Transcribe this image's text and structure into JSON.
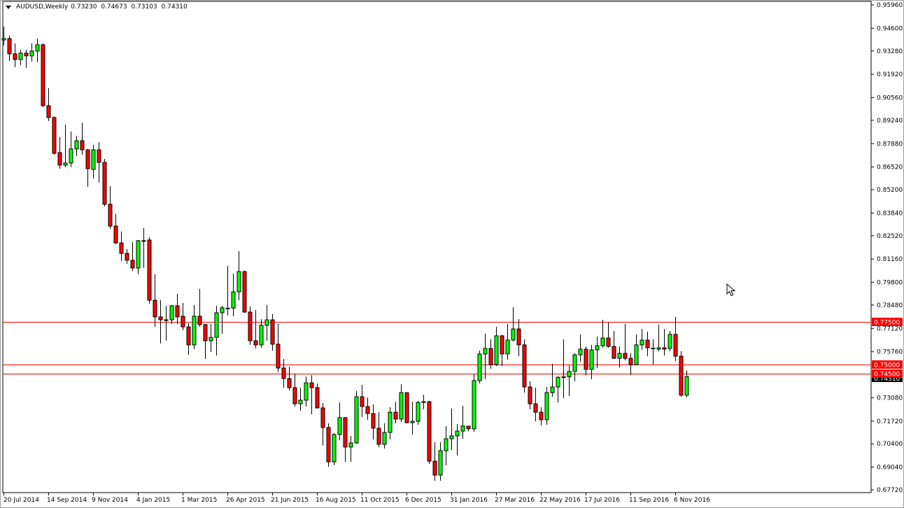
{
  "header": {
    "symbol_timeframe": "AUDUSD,Weekly",
    "open": "0.73230",
    "high": "0.74673",
    "low": "0.73103",
    "close": "0.74310"
  },
  "colors": {
    "bull": "#00ff00",
    "bear": "#ff0000",
    "outline": "#000000",
    "hline": "#ff0000",
    "bid_label_bg": "#000000"
  },
  "chart_data": {
    "type": "candlestick",
    "title": "AUDUSD,Weekly",
    "ylim": [
      0.6772,
      0.9596
    ],
    "grid": false,
    "y_ticks": [
      "0.95960",
      "0.94600",
      "0.93280",
      "0.91920",
      "0.90560",
      "0.89240",
      "0.87880",
      "0.86520",
      "0.85200",
      "0.83840",
      "0.82520",
      "0.81160",
      "0.79800",
      "0.78480",
      "0.77120",
      "0.75760",
      "0.73080",
      "0.71720",
      "0.70400",
      "0.69040",
      "0.67720"
    ],
    "x_ticks": [
      {
        "index": 0,
        "label": "20 Jul 2014"
      },
      {
        "index": 8,
        "label": "14 Sep 2014"
      },
      {
        "index": 16,
        "label": "9 Nov 2014"
      },
      {
        "index": 24,
        "label": "4 Jan 2015"
      },
      {
        "index": 32,
        "label": "1 Mar 2015"
      },
      {
        "index": 40,
        "label": "26 Apr 2015"
      },
      {
        "index": 48,
        "label": "21 Jun 2015"
      },
      {
        "index": 56,
        "label": "16 Aug 2015"
      },
      {
        "index": 64,
        "label": "11 Oct 2015"
      },
      {
        "index": 72,
        "label": "6 Dec 2015"
      },
      {
        "index": 80,
        "label": "31 Jan 2016"
      },
      {
        "index": 88,
        "label": "27 Mar 2016"
      },
      {
        "index": 96,
        "label": "22 May 2016"
      },
      {
        "index": 104,
        "label": "17 Jul 2016"
      },
      {
        "index": 112,
        "label": "11 Sep 2016"
      },
      {
        "index": 120,
        "label": "6 Nov 2016"
      }
    ],
    "horizontal_lines": [
      {
        "price": 0.775,
        "label": "0.77500"
      },
      {
        "price": 0.75,
        "label": "0.75000"
      },
      {
        "price": 0.745,
        "label": "0.74500"
      }
    ],
    "current_price": {
      "price": 0.7431,
      "label": "0.74310"
    },
    "ohlc_fields": [
      "open",
      "high",
      "low",
      "close"
    ],
    "ohlc": [
      [
        0.9392,
        0.947,
        0.936,
        0.94
      ],
      [
        0.94,
        0.9417,
        0.927,
        0.9311
      ],
      [
        0.9311,
        0.9372,
        0.9233,
        0.9278
      ],
      [
        0.9278,
        0.9335,
        0.9246,
        0.9315
      ],
      [
        0.9315,
        0.9335,
        0.9229,
        0.9299
      ],
      [
        0.9299,
        0.9372,
        0.9266,
        0.9327
      ],
      [
        0.9327,
        0.94,
        0.9262,
        0.9364
      ],
      [
        0.9364,
        0.9372,
        0.9001,
        0.9009
      ],
      [
        0.9009,
        0.9111,
        0.892,
        0.894
      ],
      [
        0.894,
        0.8948,
        0.8724,
        0.8732
      ],
      [
        0.8736,
        0.8826,
        0.8642,
        0.8663
      ],
      [
        0.8663,
        0.8899,
        0.8651,
        0.8675
      ],
      [
        0.8675,
        0.8858,
        0.8651,
        0.8757
      ],
      [
        0.8757,
        0.8834,
        0.8716,
        0.8805
      ],
      [
        0.8805,
        0.8911,
        0.8724,
        0.8752
      ],
      [
        0.8752,
        0.8757,
        0.8536,
        0.8642
      ],
      [
        0.8638,
        0.8781,
        0.8585,
        0.8752
      ],
      [
        0.8752,
        0.8797,
        0.8561,
        0.8679
      ],
      [
        0.8679,
        0.8699,
        0.8422,
        0.8435
      ],
      [
        0.8435,
        0.8541,
        0.8292,
        0.8308
      ],
      [
        0.8308,
        0.8378,
        0.8202,
        0.821
      ],
      [
        0.821,
        0.8276,
        0.8105,
        0.8149
      ],
      [
        0.8149,
        0.8174,
        0.8088,
        0.8109
      ],
      [
        0.8109,
        0.8215,
        0.8047,
        0.8064
      ],
      [
        0.8064,
        0.8227,
        0.8027,
        0.8223
      ],
      [
        0.8223,
        0.8296,
        0.8064,
        0.8223
      ],
      [
        0.8227,
        0.8243,
        0.7856,
        0.7876
      ],
      [
        0.7876,
        0.8027,
        0.7721,
        0.7779
      ],
      [
        0.7779,
        0.7876,
        0.7624,
        0.7762
      ],
      [
        0.7762,
        0.7844,
        0.764,
        0.776
      ],
      [
        0.7762,
        0.7848,
        0.7738,
        0.7844
      ],
      [
        0.7844,
        0.7913,
        0.7738,
        0.7779
      ],
      [
        0.7783,
        0.786,
        0.7701,
        0.7721
      ],
      [
        0.7721,
        0.7742,
        0.7558,
        0.7616
      ],
      [
        0.7616,
        0.7848,
        0.7591,
        0.7783
      ],
      [
        0.7783,
        0.7942,
        0.7721,
        0.7734
      ],
      [
        0.7734,
        0.7738,
        0.7534,
        0.764
      ],
      [
        0.764,
        0.7738,
        0.7575,
        0.766
      ],
      [
        0.766,
        0.7844,
        0.7554,
        0.7803
      ],
      [
        0.7803,
        0.7844,
        0.7681,
        0.7832
      ],
      [
        0.7827,
        0.8076,
        0.7787,
        0.783
      ],
      [
        0.783,
        0.8031,
        0.7783,
        0.7925
      ],
      [
        0.7925,
        0.8162,
        0.7876,
        0.8043
      ],
      [
        0.8043,
        0.8047,
        0.7803,
        0.7807
      ],
      [
        0.7807,
        0.784,
        0.7616,
        0.764
      ],
      [
        0.764,
        0.7819,
        0.7595,
        0.7616
      ],
      [
        0.7616,
        0.7766,
        0.7599,
        0.773
      ],
      [
        0.773,
        0.7848,
        0.764,
        0.7762
      ],
      [
        0.7762,
        0.7795,
        0.7583,
        0.762
      ],
      [
        0.762,
        0.7738,
        0.7457,
        0.7481
      ],
      [
        0.7481,
        0.7534,
        0.7367,
        0.742
      ],
      [
        0.742,
        0.7489,
        0.7351,
        0.7367
      ],
      [
        0.7367,
        0.7449,
        0.7257,
        0.7273
      ],
      [
        0.7273,
        0.7367,
        0.7232,
        0.7294
      ],
      [
        0.7294,
        0.7432,
        0.7257,
        0.7395
      ],
      [
        0.7395,
        0.744,
        0.7212,
        0.7367
      ],
      [
        0.7367,
        0.7391,
        0.7245,
        0.7249
      ],
      [
        0.7249,
        0.7277,
        0.7029,
        0.7135
      ],
      [
        0.7135,
        0.7159,
        0.6906,
        0.6935
      ],
      [
        0.6935,
        0.7102,
        0.6915,
        0.7094
      ],
      [
        0.7094,
        0.7281,
        0.7061,
        0.7192
      ],
      [
        0.7192,
        0.7196,
        0.6935,
        0.7021
      ],
      [
        0.7021,
        0.7086,
        0.6935,
        0.7045
      ],
      [
        0.7045,
        0.7347,
        0.704,
        0.7314
      ],
      [
        0.7314,
        0.7383,
        0.7196,
        0.7257
      ],
      [
        0.7257,
        0.731,
        0.718,
        0.7216
      ],
      [
        0.7216,
        0.7269,
        0.7065,
        0.7131
      ],
      [
        0.7131,
        0.7224,
        0.7021,
        0.7037
      ],
      [
        0.7037,
        0.7159,
        0.7012,
        0.7106
      ],
      [
        0.7106,
        0.7253,
        0.7065,
        0.7224
      ],
      [
        0.7224,
        0.7285,
        0.7159,
        0.7184
      ],
      [
        0.7184,
        0.7387,
        0.7167,
        0.7338
      ],
      [
        0.7338,
        0.734,
        0.7159,
        0.7163
      ],
      [
        0.7163,
        0.7285,
        0.7094,
        0.7171
      ],
      [
        0.7171,
        0.729,
        0.7151,
        0.7281
      ],
      [
        0.7281,
        0.7326,
        0.7241,
        0.7285
      ],
      [
        0.7285,
        0.729,
        0.6923,
        0.6939
      ],
      [
        0.6939,
        0.7049,
        0.6825,
        0.6858
      ],
      [
        0.6858,
        0.7049,
        0.6825,
        0.7
      ],
      [
        0.7,
        0.7143,
        0.6915,
        0.7069
      ],
      [
        0.7069,
        0.7245,
        0.7004,
        0.7086
      ],
      [
        0.7086,
        0.7155,
        0.6972,
        0.7114
      ],
      [
        0.7114,
        0.7261,
        0.7069,
        0.7143
      ],
      [
        0.7143,
        0.7145,
        0.7114,
        0.7127
      ],
      [
        0.7127,
        0.7444,
        0.711,
        0.7408
      ],
      [
        0.7408,
        0.7583,
        0.7391,
        0.7563
      ],
      [
        0.7563,
        0.7681,
        0.7416,
        0.7595
      ],
      [
        0.7595,
        0.7648,
        0.7477,
        0.7501
      ],
      [
        0.7501,
        0.7721,
        0.7493,
        0.7669
      ],
      [
        0.7669,
        0.7673,
        0.7493,
        0.7563
      ],
      [
        0.7563,
        0.7738,
        0.753,
        0.7644
      ],
      [
        0.7644,
        0.7836,
        0.7636,
        0.7709
      ],
      [
        0.7709,
        0.7766,
        0.755,
        0.7616
      ],
      [
        0.7616,
        0.7648,
        0.7338,
        0.7371
      ],
      [
        0.7371,
        0.7404,
        0.7241,
        0.7273
      ],
      [
        0.7273,
        0.7367,
        0.7171,
        0.7224
      ],
      [
        0.7224,
        0.7253,
        0.7147,
        0.718
      ],
      [
        0.718,
        0.7371,
        0.7151,
        0.7338
      ],
      [
        0.7338,
        0.7505,
        0.7314,
        0.7371
      ],
      [
        0.7371,
        0.7432,
        0.7281,
        0.7428
      ],
      [
        0.7428,
        0.7648,
        0.7306,
        0.743
      ],
      [
        0.743,
        0.7497,
        0.7318,
        0.7461
      ],
      [
        0.7461,
        0.7567,
        0.7404,
        0.7558
      ],
      [
        0.7558,
        0.7677,
        0.7518,
        0.7591
      ],
      [
        0.7591,
        0.7607,
        0.744,
        0.7473
      ],
      [
        0.7473,
        0.7616,
        0.7416,
        0.7587
      ],
      [
        0.7587,
        0.7664,
        0.7481,
        0.7611
      ],
      [
        0.7611,
        0.7762,
        0.7599,
        0.7656
      ],
      [
        0.7656,
        0.7746,
        0.7599,
        0.7607
      ],
      [
        0.7607,
        0.7697,
        0.7534,
        0.7538
      ],
      [
        0.7538,
        0.7607,
        0.7485,
        0.7567
      ],
      [
        0.7567,
        0.7738,
        0.7526,
        0.7538
      ],
      [
        0.7538,
        0.7567,
        0.744,
        0.7501
      ],
      [
        0.7501,
        0.7677,
        0.7499,
        0.7616
      ],
      [
        0.7616,
        0.7709,
        0.7587,
        0.7644
      ],
      [
        0.7644,
        0.7693,
        0.755,
        0.7599
      ],
      [
        0.7595,
        0.7648,
        0.7501,
        0.7597
      ],
      [
        0.7591,
        0.7734,
        0.7579,
        0.7599
      ],
      [
        0.7599,
        0.7709,
        0.7554,
        0.7591
      ],
      [
        0.7595,
        0.7697,
        0.7579,
        0.7677
      ],
      [
        0.7677,
        0.7779,
        0.7522,
        0.755
      ],
      [
        0.755,
        0.7579,
        0.7314,
        0.7323
      ],
      [
        0.7323,
        0.7467,
        0.731,
        0.7431
      ]
    ]
  }
}
